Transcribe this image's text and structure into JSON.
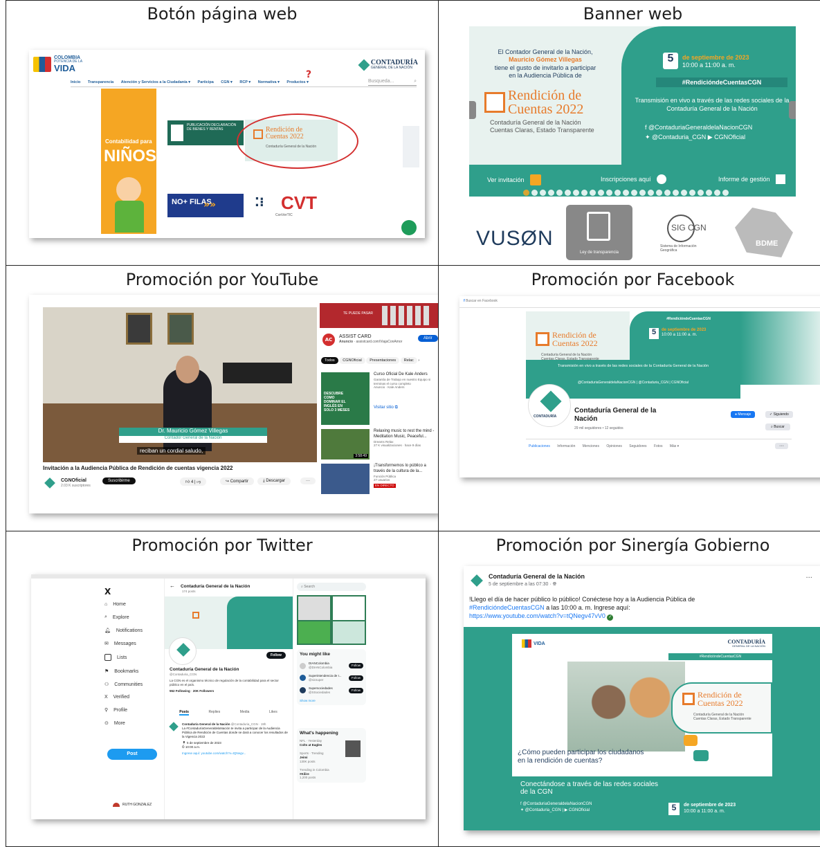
{
  "cells": {
    "boton": {
      "title": "Botón página web",
      "logo_country": "COLOMBIA",
      "logo_sub": "POTENCIA DE LA",
      "logo_word": "VIDA",
      "cgn_logo": "CONTADURÍA",
      "cgn_logo_sub": "GENERAL DE LA NACIÓN",
      "nav": [
        "Inicio",
        "Transparencia",
        "Atención y Servicios a la Ciudadanía ▾",
        "Participa",
        "CGN ▾",
        "RCP ▾",
        "Normativa ▾",
        "Productos ▾"
      ],
      "search_placeholder": "Busqueda...",
      "kids_banner_line1": "Contabilidad para",
      "kids_banner_line2": "NIÑOS",
      "declaracion_title": "PUBLICACIÓN DECLARACIÓN DE BIENES Y RENTAS",
      "rendicion_word1": "Rendición de",
      "rendicion_word2": "Cuentas 2022",
      "rendicion_sub": "Contaduría General de la Nación",
      "nofilas": "NO+ FILAS",
      "cvt": "CVT",
      "convertic": "ConVerTIC",
      "question_mark": "?",
      "colors": {
        "accent": "#e77b2b",
        "teal": "#2f9f8b",
        "highlight_ring": "#d32f2f",
        "nav_blue": "#1f5d99"
      }
    },
    "banner": {
      "title": "Banner web",
      "intro_line1": "El Contador General de la Nación,",
      "intro_name": "Mauricio Gómez Villegas",
      "intro_line2": "tiene el gusto de invitarlo a participar",
      "intro_line3": "en la Audiencia Pública de",
      "rendicion_word1": "Rendición de",
      "rendicion_word2": "Cuentas 2022",
      "cgn_line": "Contaduría General de la Nación",
      "cgn_tagline": "Cuentas Claras, Estado Transparente",
      "date_day": "5",
      "date_month": "de septiembre de 2023",
      "date_time": "10:00 a 11:00 a. m.",
      "hashtag": "#RendicióndeCuentasCGN",
      "transmission": "Transmisión en vivo a través de las redes sociales de la Contaduría General de la Nación",
      "social_fb": "@ContaduriaGeneraldelaNacionCGN",
      "social_tw": "@Contaduria_CGN",
      "social_yt": "CGNOficial",
      "btn_invitation": "Ver invitación",
      "btn_inscriptions": "Inscripciones aquí",
      "btn_report": "Informe de gestión",
      "logos": [
        "VUSØN",
        "Ley de transparencia",
        "SIG CGN",
        "BDME"
      ],
      "sig_sub": "Sistema de Información Geográfica"
    },
    "youtube": {
      "title": "Promoción por YouTube",
      "caption_name": "Dr. Mauricio Gómez Villegas",
      "caption_role": "Contador General de la Nación",
      "subtitle": "reciban un cordial saludo,",
      "video_title": "Invitación a la Audiencia Pública de Rendición de cuentas vigencia 2022",
      "channel": "CGNOficial",
      "subscribers": "2.03 K suscriptores",
      "subscribe_btn": "Suscribirme",
      "likes": "4",
      "share": "Compartir",
      "download": "Descargar",
      "ad_brand": "ASSIST CARD",
      "ad_label": "Anuncio",
      "ad_url": "assistcard.com/ViajaConAmor",
      "ad_btn": "Abrir",
      "ad_banner": "TE PUEDE PASAR",
      "chips": [
        "Todos",
        "CGNOficial",
        "Presentaciones",
        "Relac"
      ],
      "rec1_title": "Curso Oficial De Kale Anders",
      "rec1_desc": "Garantía de Trabajo en nuestro Equipo si terminas el curso completo",
      "rec1_meta": "Anuncio · Kale Anders",
      "rec1_btn": "Visitar sitio",
      "rec1_thumb": "DESCUBRE COMO DOMINAR EL INGLÉS EN SOLO 3 MESES",
      "rec2_title": "Relaxing music to rest the mind - Meditation Music, Peaceful...",
      "rec2_channel": "Dreams Relax",
      "rec2_meta": "27 K visualizaciones · hace 9 días",
      "rec2_duration": "3:58:49",
      "rec3_title": "¡Transformemos lo público a través de la cultura de la...",
      "rec3_channel": "Función Pública",
      "rec3_meta": "27 usuarios",
      "rec3_live": "EN DIRECTO"
    },
    "facebook": {
      "title": "Promoción por Facebook",
      "search_placeholder": "Buscar en Facebook",
      "hashtag": "#RendicióndeCuentasCGN",
      "rendicion_word1": "Rendición de",
      "rendicion_word2": "Cuentas 2022",
      "cgn_line": "Contaduría General de la Nación",
      "cgn_tagline": "Cuentas Claras, Estado Transparente",
      "date_day": "5",
      "date_month": "de septiembre de 2023",
      "date_time": "10:00 a 11:00 a. m.",
      "transmission": "Transmisión en vivo a través de las redes sociales de la Contaduría General de la Nación",
      "social_line": "@ContaduriaGeneraldelaNacionCGN | @Contaduria_CGN | CGNOficial",
      "page_name_line1": "Contaduría General de la",
      "page_name_line2": "Nación",
      "followers": "29 mil seguidores • 12 seguidos",
      "btn_message": "Mensaje",
      "btn_following": "Siguiendo",
      "btn_search": "Buscar",
      "tabs": [
        "Publicaciones",
        "Información",
        "Menciones",
        "Opiniones",
        "Seguidores",
        "Fotos",
        "Más ▾"
      ],
      "avatar_caption": "CONTADURÍA"
    },
    "twitter": {
      "title": "Promoción por Twitter",
      "header_name": "Contaduría General de la Nación",
      "header_posts": "174 posts",
      "sidebar": [
        "Home",
        "Explore",
        "Notifications",
        "Messages",
        "Lists",
        "Bookmarks",
        "Communities",
        "Verified",
        "Profile",
        "More"
      ],
      "post_btn": "Post",
      "user": "RUTH GONZALEZ",
      "profile_name": "Contaduría General de la Nación",
      "handle": "@Contaduria_CGN",
      "bio": "La CGN es el organismo técnico de regulación de la contabilidad para el sector público en el país.",
      "following": "552 Following",
      "followers": "20K Followers",
      "follow_btn": "Follow",
      "tabs": [
        "Posts",
        "Replies",
        "Media",
        "Likes"
      ],
      "tweet_author": "Contaduría General de la Nación",
      "tweet_handle": "@Contaduria_CGN · 19h",
      "tweet_text": "La #ContaduríaGeneraldelaNación te invita a participar de la Audiencia Pública de Rendición de Cuentas donde se dará a conocer los resultados de la Vigencia 2022",
      "tweet_date": "5 de septiembre de 2023",
      "tweet_time": "10:00 a.m.",
      "tweet_link": "Ingrese aquí: youtube.com/watch?v=tQNegv...",
      "search_placeholder": "Search",
      "might_like_title": "You might like",
      "suggestions": [
        {
          "name": "DIANColombia",
          "handle": "@DIANColombia"
        },
        {
          "name": "Superintendencia de I...",
          "handle": "@sicsuper"
        },
        {
          "name": "Supersociedades",
          "handle": "@SSociedades"
        }
      ],
      "show_more": "Show more",
      "happening_title": "What's happening",
      "trends": [
        {
          "context": "NFL · Yesterday",
          "name": "Colts at Eagles"
        },
        {
          "context": "Sports · Trending",
          "name": "Jeimi",
          "count": "130K posts"
        },
        {
          "context": "Trending in Colombia",
          "name": "#Kilire",
          "count": "1,200 posts"
        }
      ]
    },
    "sinergia": {
      "title": "Promoción por Sinergía Gobierno",
      "author": "Contaduría General de la Nación",
      "date": "5 de septiembre a las 07:30 ·",
      "menu": "···",
      "text_line1": "!Llego el día de hacer público lo público! Conéctese hoy a la Audiencia Pública de",
      "hashtag": "#RendicióndeCuentasCGN",
      "text_line2": "a las 10:00 a. m. Ingrese aquí:",
      "link": "https://www.youtube.com/watch?v=tQNegv47vV0",
      "logo_word": "VIDA",
      "cgn_logo": "CONTADURÍA",
      "cgn_logo_sub": "GENERAL DE LA NACIÓN",
      "hashtag_small": "#RendicióndeCuentasCGN",
      "rendicion_word1": "Rendición de",
      "rendicion_word2": "Cuentas 2022",
      "cgn_line": "Contaduría General de la Nación",
      "cgn_tagline": "Cuentas Claras, Estado Transparente",
      "question": "¿Cómo pueden participar los ciudadanos en la rendición de cuentas?",
      "connect": "Conectándose a través de las redes sociales de la CGN",
      "social_fb": "@ContaduriaGeneraldelaNacionCGN",
      "social_tw": "@Contaduria_CGN",
      "social_yt": "CGNOficial",
      "date_day": "5",
      "date_month": "de septiembre de 2023",
      "date_time": "10:00 a 11:00 a. m."
    }
  }
}
